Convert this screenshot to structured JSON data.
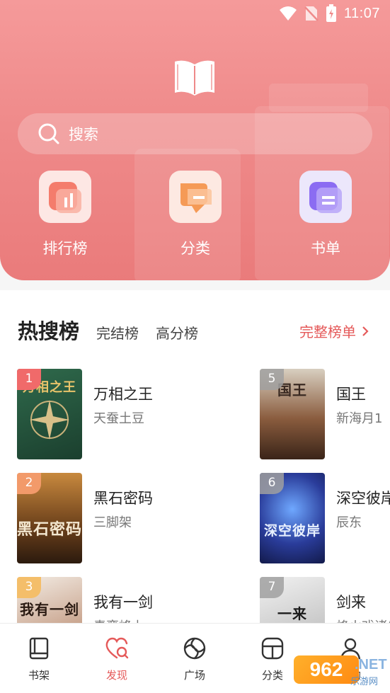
{
  "status": {
    "time": "11:07"
  },
  "search": {
    "placeholder": "搜索"
  },
  "quick_links": [
    {
      "label": "排行榜",
      "icon": "ranking-icon"
    },
    {
      "label": "分类",
      "icon": "category-icon"
    },
    {
      "label": "书单",
      "icon": "booklist-icon"
    }
  ],
  "tabs": {
    "main": "热搜榜",
    "sub1": "完结榜",
    "sub2": "高分榜",
    "full": "完整榜单"
  },
  "books": [
    {
      "rank": "1",
      "title": "万相之王",
      "author": "天蚕土豆",
      "cover_text": "万相之王"
    },
    {
      "rank": "2",
      "title": "黑石密码",
      "author": "三脚架",
      "cover_text": "黑石密码"
    },
    {
      "rank": "3",
      "title": "我有一剑",
      "author": "青鸾峰上",
      "cover_text": "我有一剑"
    },
    {
      "rank": "5",
      "title": "国王",
      "author": "新海月1",
      "cover_text": "国王"
    },
    {
      "rank": "6",
      "title": "深空彼岸",
      "author": "辰东",
      "cover_text": "深空彼岸"
    },
    {
      "rank": "7",
      "title": "剑来",
      "author": "烽火戏诸侯",
      "cover_text": "一来"
    }
  ],
  "nav": [
    {
      "label": "书架",
      "icon": "bookshelf-icon"
    },
    {
      "label": "发现",
      "icon": "discover-icon"
    },
    {
      "label": "广场",
      "icon": "plaza-icon"
    },
    {
      "label": "分类",
      "icon": "category-icon"
    },
    {
      "label": "我的",
      "icon": "profile-icon"
    }
  ],
  "watermark": {
    "brand": "962",
    "net": ".NET",
    "sub": "乐游网"
  },
  "colors": {
    "accent": "#e55a5a",
    "hero": "#ef8a8a"
  }
}
